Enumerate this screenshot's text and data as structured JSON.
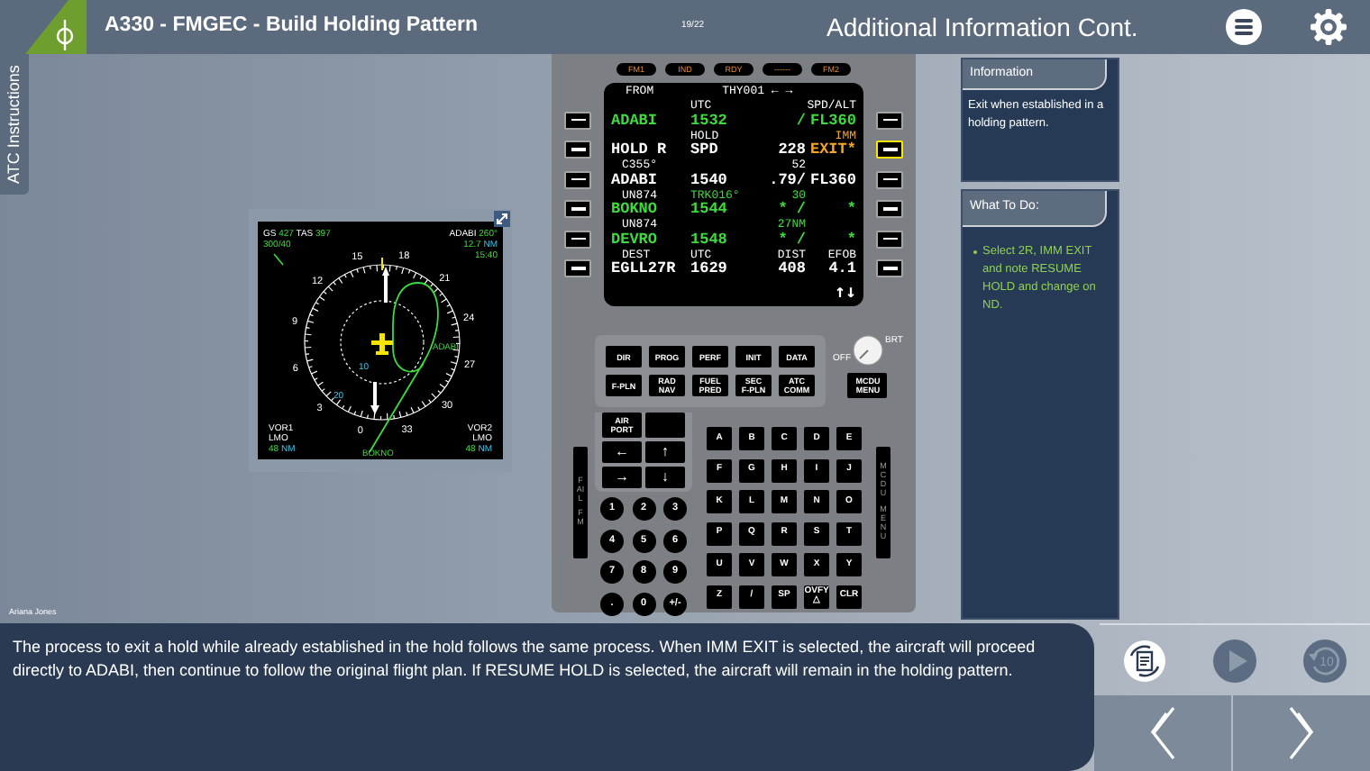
{
  "header": {
    "title": "A330 - FMGEC - Build Holding Pattern",
    "page": "19/22",
    "section_title": "Additional Information Cont."
  },
  "side_tab": {
    "label": "ATC Instructions"
  },
  "nd": {
    "ground_speed": {
      "label": "GS",
      "value": "427"
    },
    "true_airspeed": {
      "label": "TAS",
      "value": "397"
    },
    "wind": "300/40",
    "waypoint": {
      "name": "ADABI",
      "bearing": "260°",
      "distance": "12.7",
      "unit": "NM",
      "eta": "15:40"
    },
    "compass_labels": [
      "15",
      "18",
      "21",
      "24",
      "27",
      "30",
      "33",
      "0",
      "3",
      "6",
      "9",
      "12"
    ],
    "range_labels": [
      "10",
      "20"
    ],
    "route_labels": [
      "ADABI",
      "BOKNO"
    ],
    "nav_sources": [
      {
        "name": "VOR1",
        "ident": "LMO",
        "distance": "48",
        "unit": "NM"
      },
      {
        "name": "VOR2",
        "ident": "LMO",
        "distance": "48",
        "unit": "NM"
      }
    ]
  },
  "mcdu": {
    "annunciators": [
      "FM1",
      "IND",
      "RDY",
      "------",
      "FM2"
    ],
    "rows": [
      {
        "kind": "title",
        "left": {
          "text": "FROM",
          "color": "#ffffff"
        },
        "middle": {
          "text": "THY001 ← →",
          "color": "#ffffff"
        }
      },
      {
        "kind": "label",
        "middle": {
          "text": "UTC",
          "color": "#ffffff"
        },
        "right": {
          "text": "SPD/ALT",
          "color": "#ffffff"
        }
      },
      {
        "kind": "data",
        "left": {
          "text": "ADABI",
          "color": "#3cdc3c"
        },
        "middle": {
          "text": "1532",
          "color": "#3cdc3c"
        },
        "right_inner": {
          "text": "/",
          "color": "#3cdc3c"
        },
        "right": {
          "text": "FL360",
          "color": "#3cdc3c"
        }
      },
      {
        "kind": "label",
        "middle": {
          "text": "HOLD",
          "color": "#ffffff"
        },
        "right": {
          "text": "IMM",
          "color": "#f5a623"
        }
      },
      {
        "kind": "data",
        "left": {
          "text": "HOLD R",
          "color": "#ffffff"
        },
        "middle": {
          "text": "SPD",
          "color": "#ffffff"
        },
        "right_inner": {
          "text": "228",
          "color": "#ffffff"
        },
        "right": {
          "text": "EXIT*",
          "color": "#f5a623"
        }
      },
      {
        "kind": "label",
        "left": {
          "text": "C355°",
          "color": "#ffffff"
        },
        "right_inner": {
          "text": "52",
          "color": "#ffffff"
        }
      },
      {
        "kind": "data",
        "left": {
          "text": "ADABI",
          "color": "#ffffff"
        },
        "middle": {
          "text": "1540",
          "color": "#ffffff"
        },
        "right_inner": {
          "text": ".79/",
          "color": "#ffffff"
        },
        "right": {
          "text": "FL360",
          "color": "#ffffff"
        }
      },
      {
        "kind": "label",
        "left": {
          "text": "UN874",
          "color": "#ffffff"
        },
        "middle": {
          "text": "TRK016°",
          "color": "#3cdc3c"
        },
        "right_inner": {
          "text": "30",
          "color": "#3cdc3c"
        }
      },
      {
        "kind": "data",
        "left": {
          "text": "BOKNO",
          "color": "#3cdc3c"
        },
        "middle": {
          "text": "1544",
          "color": "#3cdc3c"
        },
        "right_inner": {
          "text": "* /",
          "color": "#3cdc3c"
        },
        "right": {
          "text": "*",
          "color": "#3cdc3c"
        }
      },
      {
        "kind": "label",
        "left": {
          "text": "UN874",
          "color": "#ffffff"
        },
        "right_inner": {
          "text": "27NM",
          "color": "#3cdc3c"
        }
      },
      {
        "kind": "data",
        "left": {
          "text": "DEVRO",
          "color": "#3cdc3c"
        },
        "middle": {
          "text": "1548",
          "color": "#3cdc3c"
        },
        "right_inner": {
          "text": "* /",
          "color": "#3cdc3c"
        },
        "right": {
          "text": "*",
          "color": "#3cdc3c"
        }
      },
      {
        "kind": "label",
        "left": {
          "text": "DEST",
          "color": "#ffffff"
        },
        "middle": {
          "text": "UTC",
          "color": "#ffffff"
        },
        "right_inner": {
          "text": "DIST",
          "color": "#ffffff"
        },
        "right": {
          "text": "EFOB",
          "color": "#ffffff"
        }
      },
      {
        "kind": "data",
        "left": {
          "text": "EGLL27R",
          "color": "#ffffff"
        },
        "middle": {
          "text": "1629",
          "color": "#ffffff"
        },
        "right_inner": {
          "text": "408",
          "color": "#ffffff"
        },
        "right": {
          "text": "4.1",
          "color": "#ffffff"
        }
      },
      {
        "kind": "scratchpad",
        "right": {
          "text": "↑↓",
          "color": "#ffffff"
        }
      }
    ],
    "lsk_left": [
      {
        "highlighted": false
      },
      {
        "highlighted": false
      },
      {
        "highlighted": false
      },
      {
        "highlighted": false
      },
      {
        "highlighted": false
      },
      {
        "highlighted": false
      }
    ],
    "lsk_right": [
      {
        "highlighted": false
      },
      {
        "highlighted": true
      },
      {
        "highlighted": false
      },
      {
        "highlighted": false
      },
      {
        "highlighted": false
      },
      {
        "highlighted": false
      }
    ],
    "brightness": {
      "label": "BRT",
      "off_label": "OFF"
    },
    "function_keys": [
      "DIR",
      "PROG",
      "PERF",
      "INIT",
      "DATA",
      "F-PLN",
      "RAD NAV",
      "FUEL PRED",
      "SEC F-PLN",
      "ATC COMM"
    ],
    "menu_key": "MCDU MENU",
    "nav_keys": [
      {
        "kind": "label",
        "label": "AIR PORT"
      },
      {
        "kind": "blank"
      },
      {
        "kind": "arrow",
        "label": "←"
      },
      {
        "kind": "arrow",
        "label": "↑"
      },
      {
        "kind": "arrow",
        "label": "→"
      },
      {
        "kind": "arrow",
        "label": "↓"
      }
    ],
    "number_keys": [
      "1",
      "2",
      "3",
      "4",
      "5",
      "6",
      "7",
      "8",
      "9",
      ".",
      "0",
      "+/-"
    ],
    "letter_keys": [
      "A",
      "B",
      "C",
      "D",
      "E",
      "F",
      "G",
      "H",
      "I",
      "J",
      "K",
      "L",
      "M",
      "N",
      "O",
      "P",
      "Q",
      "R",
      "S",
      "T",
      "U",
      "V",
      "W",
      "X",
      "Y",
      "Z",
      "/",
      "SP",
      "OVFY △",
      "CLR"
    ],
    "fail_annunciator": [
      "FAIL",
      "FM"
    ],
    "menu_annunciator": [
      "MCDU",
      "MENU"
    ]
  },
  "info_panel": {
    "title": "Information",
    "text": "Exit when established in a holding pattern."
  },
  "todo_panel": {
    "title": "What To Do:",
    "items": [
      "Select 2R, IMM EXIT and note RESUME HOLD and change on ND."
    ]
  },
  "presenter": "Ariana Jones",
  "narration": "The process to exit a hold while already established in the hold follows the same process. When IMM EXIT is selected, the aircraft will proceed directly to ADABI, then continue to follow the original flight plan. If RESUME HOLD is selected, the aircraft will remain in the holding pattern.",
  "controls": {
    "replay_seconds": "10"
  }
}
